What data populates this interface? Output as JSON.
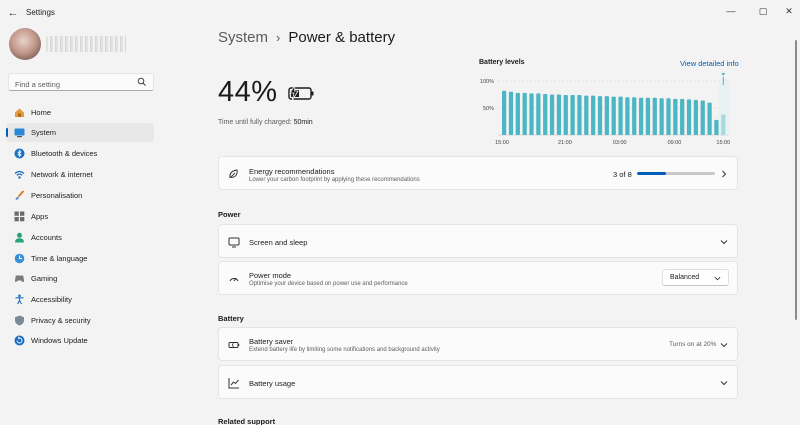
{
  "window": {
    "app_title": "Settings",
    "controls": {
      "minimize": "—",
      "maximize": "▢",
      "close": "✕"
    }
  },
  "search": {
    "placeholder": "Find a setting"
  },
  "sidebar": {
    "items": [
      {
        "label": "Home",
        "icon": "home-icon",
        "active": false
      },
      {
        "label": "System",
        "icon": "system-icon",
        "active": true
      },
      {
        "label": "Bluetooth & devices",
        "icon": "bluetooth-icon",
        "active": false
      },
      {
        "label": "Network & internet",
        "icon": "wifi-icon",
        "active": false
      },
      {
        "label": "Personalisation",
        "icon": "brush-icon",
        "active": false
      },
      {
        "label": "Apps",
        "icon": "apps-icon",
        "active": false
      },
      {
        "label": "Accounts",
        "icon": "accounts-icon",
        "active": false
      },
      {
        "label": "Time & language",
        "icon": "globe-clock-icon",
        "active": false
      },
      {
        "label": "Gaming",
        "icon": "gamepad-icon",
        "active": false
      },
      {
        "label": "Accessibility",
        "icon": "accessibility-icon",
        "active": false
      },
      {
        "label": "Privacy & security",
        "icon": "shield-icon",
        "active": false
      },
      {
        "label": "Windows Update",
        "icon": "update-icon",
        "active": false
      }
    ]
  },
  "breadcrumb": {
    "parent": "System",
    "separator": "›",
    "current": "Power & battery"
  },
  "battery": {
    "percent": "44%",
    "charge_label": "Time until fully charged:",
    "charge_value": "50min"
  },
  "battery_levels": {
    "title": "Battery levels",
    "link": "View detailed info"
  },
  "chart_data": {
    "type": "bar",
    "title": "Battery levels",
    "y_ticks": [
      "100%",
      "50%"
    ],
    "x_ticks": [
      "15:00",
      "21:00",
      "03:00",
      "09:00",
      "15:00"
    ],
    "ylim": [
      0,
      100
    ],
    "values": [
      82,
      80,
      78,
      78,
      77,
      77,
      76,
      75,
      75,
      74,
      74,
      74,
      73,
      73,
      72,
      72,
      71,
      71,
      70,
      70,
      69,
      69,
      69,
      68,
      68,
      67,
      67,
      66,
      65,
      64,
      60,
      28,
      38
    ],
    "colors": {
      "bar": "#4db6c4",
      "current_marker": "#4db6c4",
      "grid": "#d0d0d0"
    }
  },
  "energy_card": {
    "title": "Energy recommendations",
    "subtitle": "Lower your carbon footprint by applying these recommendations",
    "count": "3 of 8",
    "progress": 0.375
  },
  "sections": {
    "power": "Power",
    "battery": "Battery",
    "related": "Related support"
  },
  "power": {
    "screen_sleep": {
      "title": "Screen and sleep"
    },
    "power_mode": {
      "title": "Power mode",
      "subtitle": "Optimise your device based on power use and performance",
      "value": "Balanced"
    }
  },
  "battery_section": {
    "saver": {
      "title": "Battery saver",
      "subtitle": "Extend battery life by limiting some notifications and background activity",
      "status": "Turns on at 20%"
    },
    "usage": {
      "title": "Battery usage"
    }
  },
  "colors": {
    "accent": "#005fb8",
    "bar": "#4db6c4",
    "background": "#f3f3f3",
    "card": "#fbfbfb"
  }
}
